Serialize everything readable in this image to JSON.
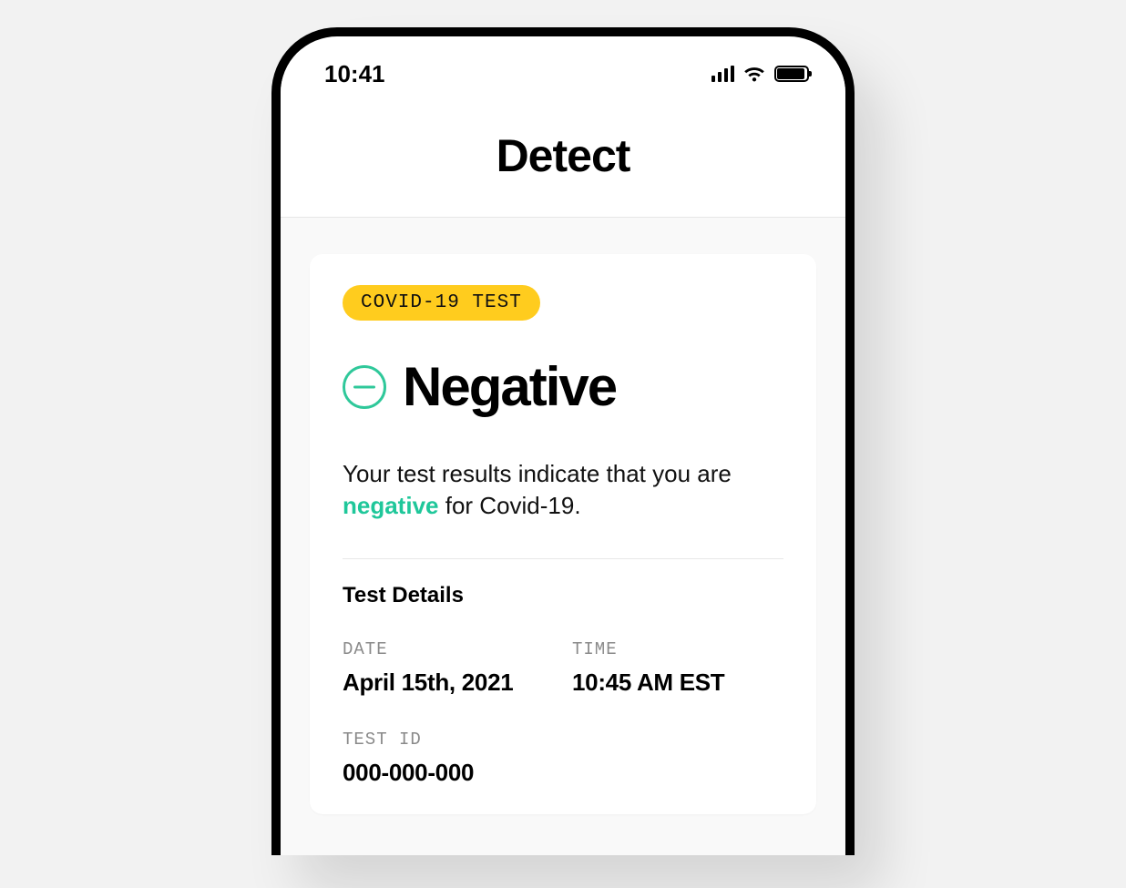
{
  "status_bar": {
    "time": "10:41"
  },
  "header": {
    "title": "Detect"
  },
  "result_card": {
    "badge": "COVID-19 TEST",
    "status": "Negative",
    "desc_prefix": "Your test results indicate that you are ",
    "desc_highlight": "negative",
    "desc_suffix": " for Covid-19.",
    "details_heading": "Test Details",
    "details": {
      "date_label": "DATE",
      "date_value": "April 15th, 2021",
      "time_label": "TIME",
      "time_value": "10:45 AM EST",
      "testid_label": "TEST ID",
      "testid_value": "000-000-000"
    }
  }
}
